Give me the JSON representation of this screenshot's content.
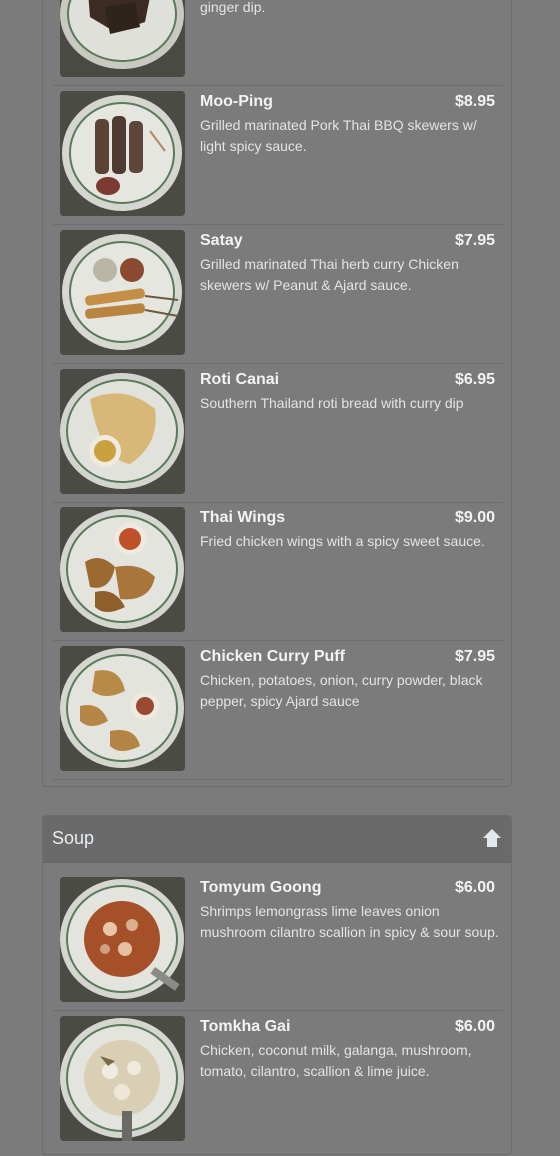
{
  "appetizers": {
    "items": [
      {
        "name": "",
        "price": "",
        "desc": "ginger dip."
      },
      {
        "name": "Moo-Ping",
        "price": "$8.95",
        "desc": "Grilled marinated Pork Thai BBQ skewers w/ light spicy sauce."
      },
      {
        "name": "Satay",
        "price": "$7.95",
        "desc": "Grilled marinated Thai herb curry Chicken skewers w/ Peanut & Ajard sauce."
      },
      {
        "name": "Roti Canai",
        "price": "$6.95",
        "desc": "Southern Thailand roti bread with curry dip"
      },
      {
        "name": "Thai Wings",
        "price": "$9.00",
        "desc": "Fried chicken wings with a spicy sweet sauce."
      },
      {
        "name": "Chicken Curry Puff",
        "price": "$7.95",
        "desc": "Chicken, potatoes, onion, curry powder, black pepper, spicy Ajard sauce"
      }
    ]
  },
  "soup": {
    "title": "Soup",
    "items": [
      {
        "name": "Tomyum Goong",
        "price": "$6.00",
        "desc": "Shrimps lemongrass lime leaves onion mushroom cilantro scallion in spicy & sour soup."
      },
      {
        "name": "Tomkha Gai",
        "price": "$6.00",
        "desc": "Chicken, coconut milk, galanga, mushroom, tomato, cilantro, scallion & lime juice."
      }
    ]
  },
  "icons": {
    "back_to_top": "arrow-up-icon"
  },
  "colors": {
    "overlay_bg": "#7b7b7b",
    "heading_bg": "#6a6a6a"
  }
}
